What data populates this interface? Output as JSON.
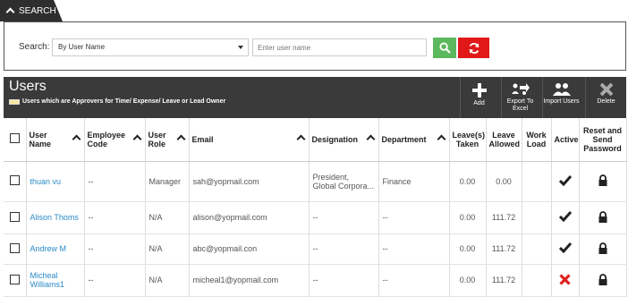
{
  "search": {
    "tab_label": "SEARCH",
    "label": "Search:",
    "select_value": "By User Name",
    "placeholder": "Enter user name"
  },
  "users_panel": {
    "title": "Users",
    "legend_text": "Users which are Approvers for Time/ Expense/ Leave or Lead Owner",
    "legend_color": "#f7e6a0",
    "toolbar": [
      {
        "label": "Add",
        "icon": "plus-icon"
      },
      {
        "label": "Export To Excel",
        "icon": "export-icon"
      },
      {
        "label": "Import Users",
        "icon": "import-users-icon"
      },
      {
        "label": "Delete",
        "icon": "delete-x-icon"
      }
    ]
  },
  "table": {
    "columns": [
      "User Name",
      "Employee Code",
      "User Role",
      "Email",
      "Designation",
      "Department",
      "Leave(s) Taken",
      "Leave Allowed",
      "Work Load",
      "Active",
      "Reset and Send Password"
    ],
    "rows": [
      {
        "name": "thuan vu",
        "code": "--",
        "role": "Manager",
        "email": "sah@yopmail.com",
        "designation": "President, Global Corpora...",
        "department": "Finance",
        "taken": "0.00",
        "allowed": "0.00",
        "workload": "",
        "active": true
      },
      {
        "name": "Alison Thoms",
        "code": "--",
        "role": "N/A",
        "email": "alison@yopmail.com",
        "designation": "--",
        "department": "--",
        "taken": "0.00",
        "allowed": "111.72",
        "workload": "",
        "active": true
      },
      {
        "name": "Andrew M",
        "code": "--",
        "role": "N/A",
        "email": "abc@yopmail.con",
        "designation": "--",
        "department": "--",
        "taken": "0.00",
        "allowed": "111.72",
        "workload": "",
        "active": true
      },
      {
        "name": "Micheal Williams1",
        "code": "--",
        "role": "N/A",
        "email": "micheal1@yopmail.com",
        "designation": "--",
        "department": "--",
        "taken": "0.00",
        "allowed": "111.72",
        "workload": "",
        "active": false
      }
    ]
  },
  "colors": {
    "go_button": "#5cb85c",
    "reset_button": "#e01818",
    "link": "#2a8ac8",
    "header_bar": "#3a3a3a",
    "inactive_x": "#e02020"
  }
}
